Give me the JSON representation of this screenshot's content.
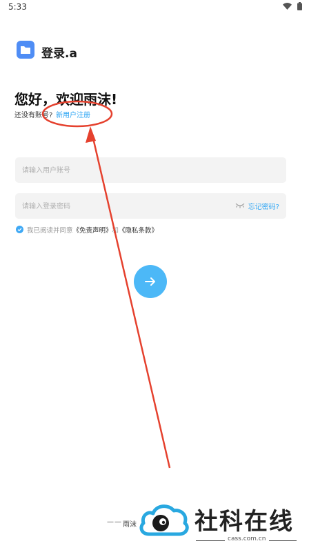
{
  "status_bar": {
    "time": "5:33"
  },
  "header": {
    "app_title": "登录.a"
  },
  "greeting": {
    "title": "您好，欢迎雨沫!",
    "no_account": "还没有账号?",
    "register_link": "新用户注册"
  },
  "form": {
    "account_placeholder": "请输入用户账号",
    "password_placeholder": "请输入登录密码",
    "forgot_link": "忘记密码?"
  },
  "agreement": {
    "prefix": "我已阅读并同意",
    "disclaimer": "《免责声明》",
    "and": "和",
    "privacy": "《隐私条款》"
  },
  "footer": {
    "dashes": "——",
    "text": "雨沫"
  },
  "watermark": {
    "title": "社科在线",
    "domain": "cass.com.cn"
  },
  "colors": {
    "accent": "#2aa4f4",
    "button": "#4cb8f7",
    "annotation": "#e5412e",
    "logo": "#4f8df5"
  }
}
